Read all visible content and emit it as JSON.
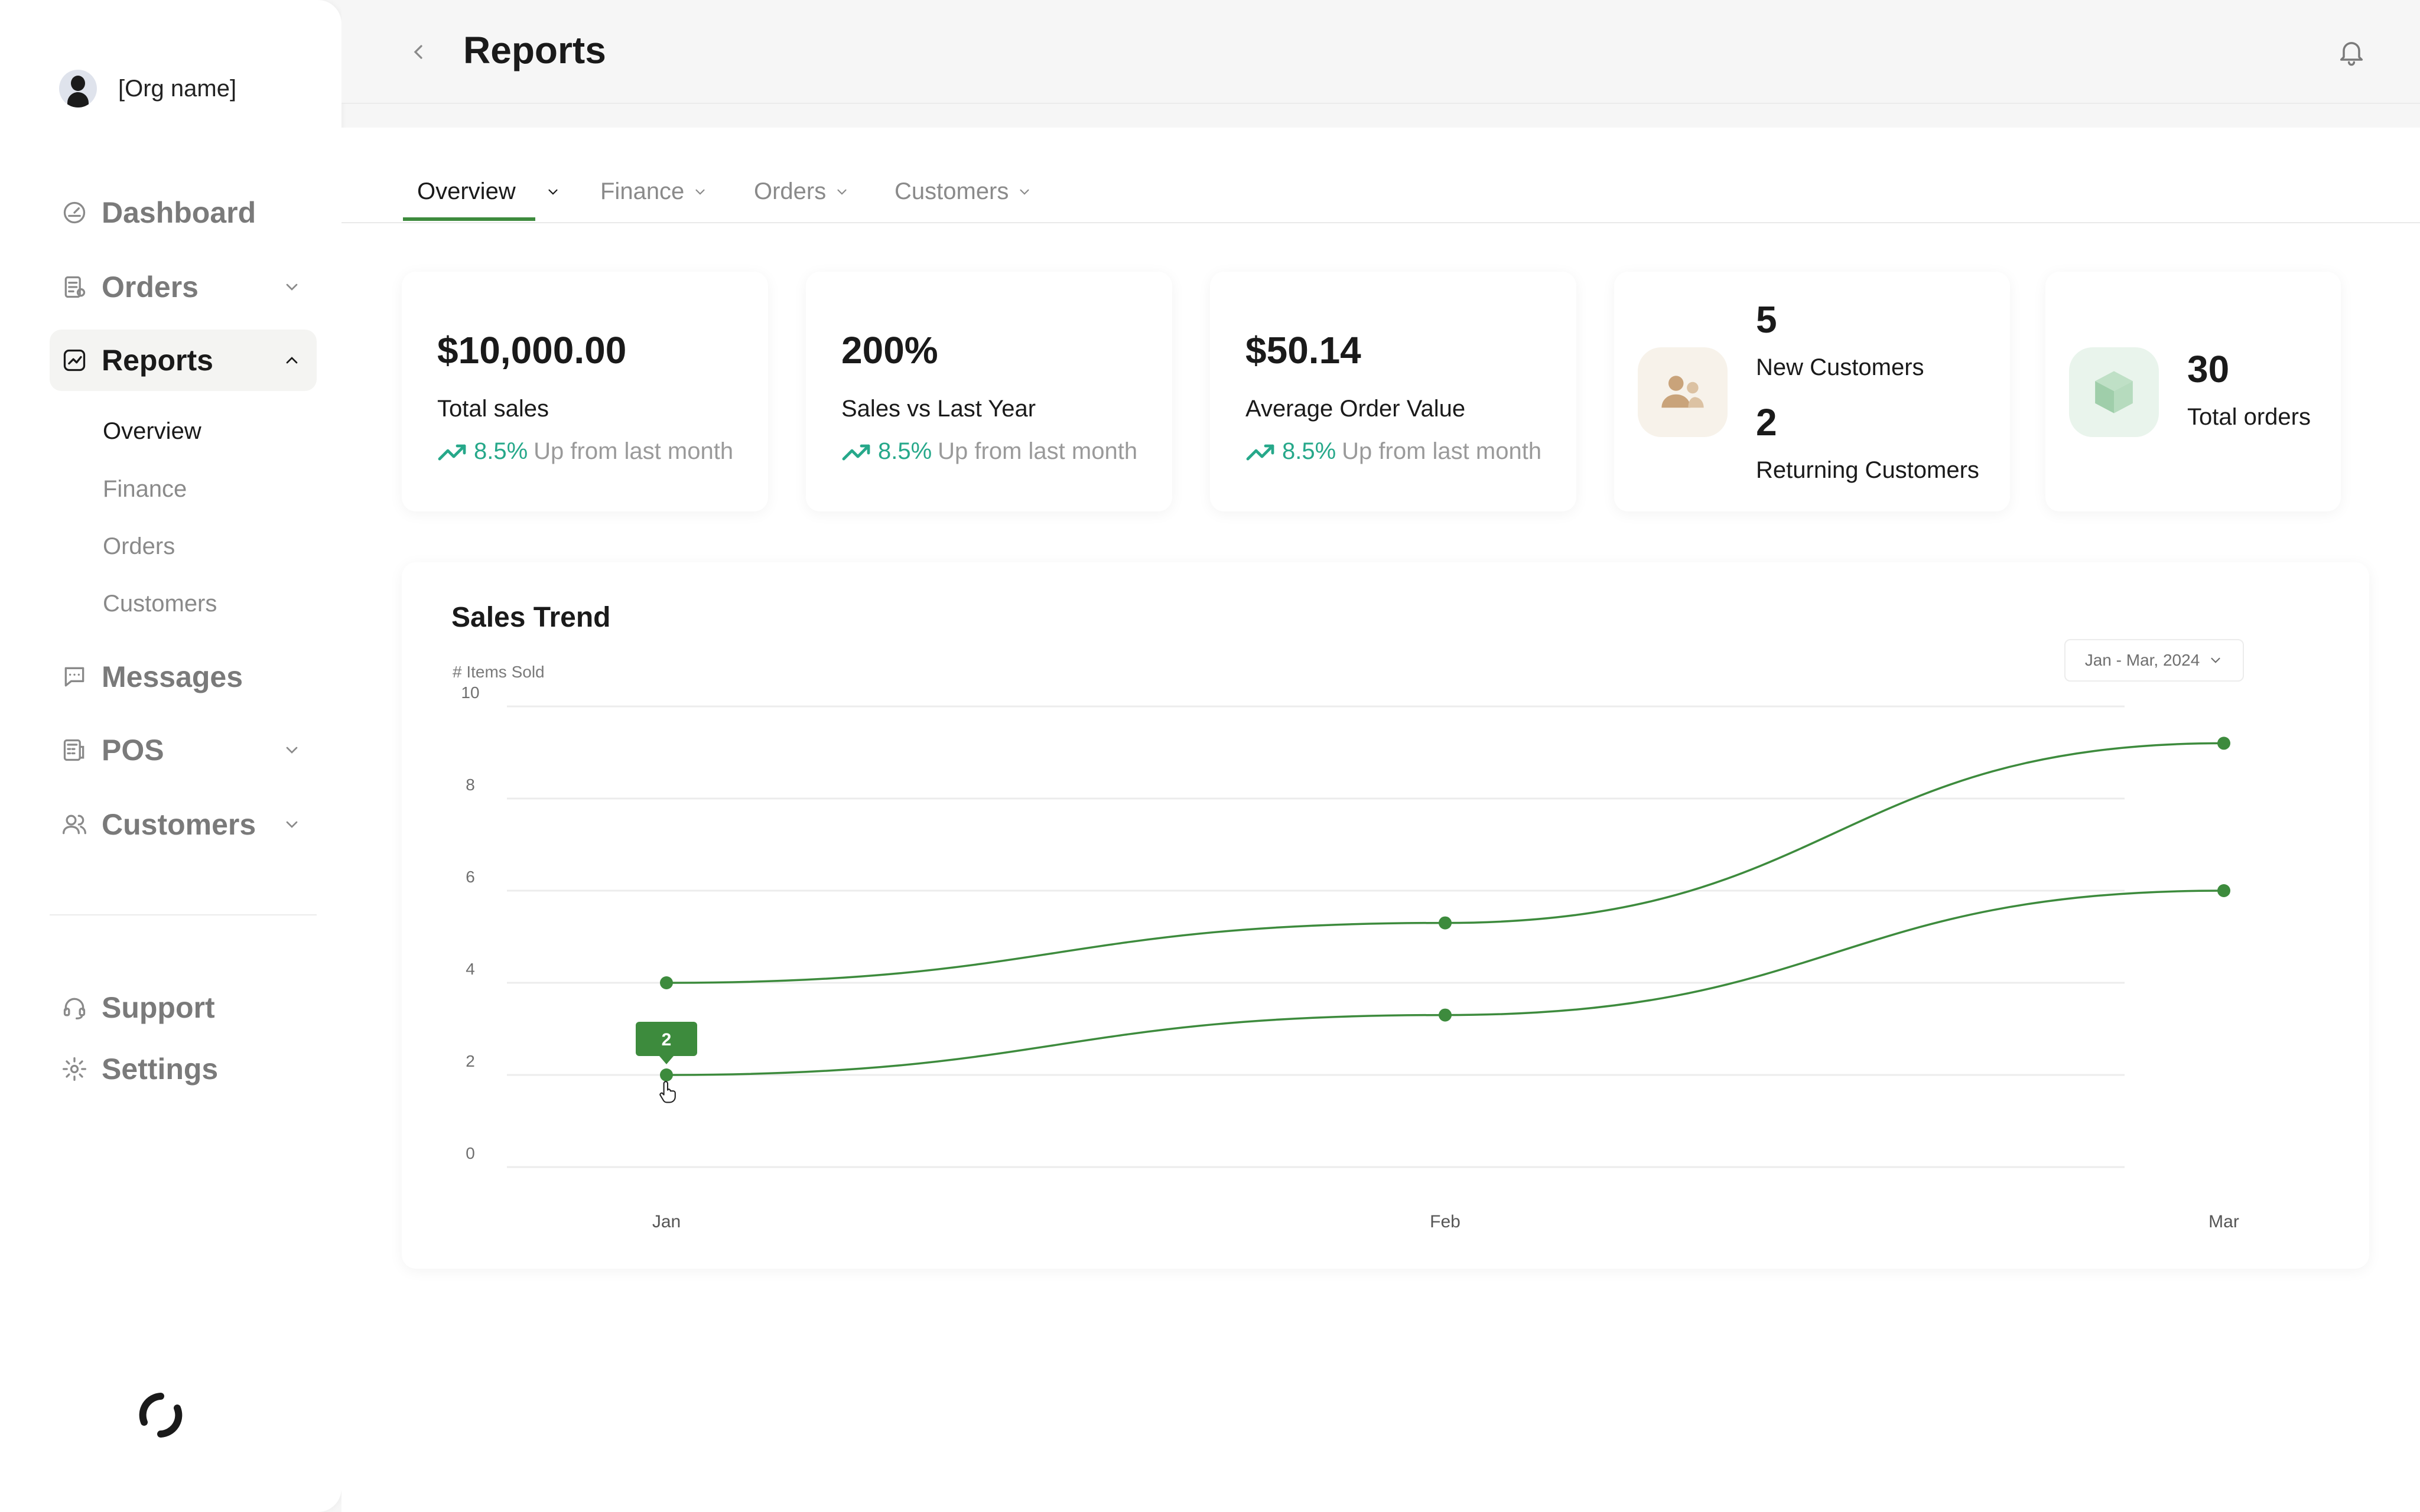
{
  "org": {
    "name": "[Org name]"
  },
  "nav": {
    "dashboard": "Dashboard",
    "orders": "Orders",
    "reports": "Reports",
    "messages": "Messages",
    "pos": "POS",
    "customers": "Customers",
    "support": "Support",
    "settings": "Settings"
  },
  "reports_sub": [
    "Overview",
    "Finance",
    "Orders",
    "Customers"
  ],
  "header": {
    "title": "Reports"
  },
  "tabs": [
    "Overview",
    "Finance",
    "Orders",
    "Customers"
  ],
  "stats": [
    {
      "value": "$10,000.00",
      "label": "Total sales",
      "pct": "8.5%",
      "trend_text": "Up from last month"
    },
    {
      "value": "200%",
      "label": "Sales vs Last Year",
      "pct": "8.5%",
      "trend_text": "Up from last month"
    },
    {
      "value": "$50.14",
      "label": "Average Order Value",
      "pct": "8.5%",
      "trend_text": "Up from last month"
    }
  ],
  "customers_card": {
    "new_count": "5",
    "new_label": "New Customers",
    "returning_count": "2",
    "returning_label": "Returning Customers"
  },
  "orders_card": {
    "count": "30",
    "label": "Total orders"
  },
  "colors": {
    "accent": "#3d8b3d",
    "trend": "#26a88a",
    "cust_icon": "#c9a37a",
    "order_icon": "#9fceaa"
  },
  "chart": {
    "title": "Sales Trend",
    "ylabel": "# Items Sold",
    "range_label": "Jan - Mar, 2024",
    "tooltip_value": "2"
  },
  "chart_data": {
    "type": "line",
    "categories": [
      "Jan",
      "Feb",
      "Mar"
    ],
    "series": [
      {
        "values": [
          4,
          5.3,
          9.2
        ]
      },
      {
        "values": [
          2,
          3.3,
          6
        ]
      }
    ],
    "ylim": [
      0,
      10
    ],
    "yticks": [
      0,
      2,
      4,
      6,
      8,
      10
    ],
    "grid": true
  }
}
